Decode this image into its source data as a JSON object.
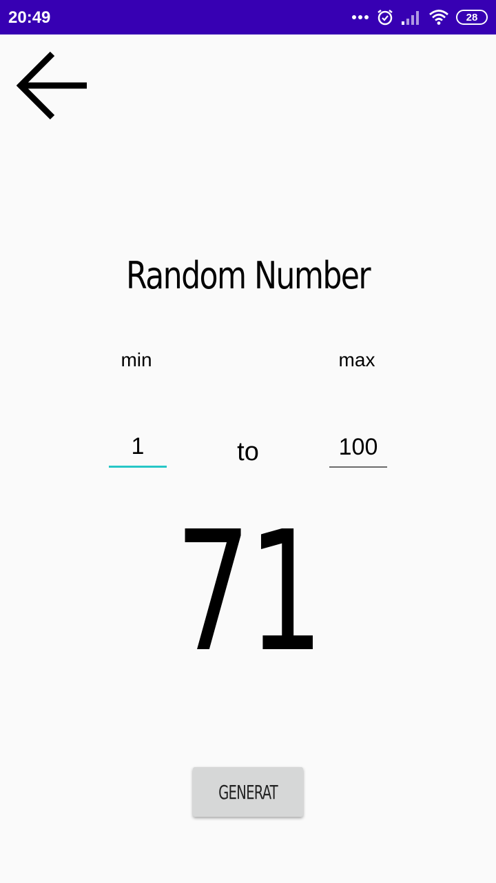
{
  "status_bar": {
    "time": "20:49",
    "battery": "28",
    "background_color": "#3700b3",
    "icons": [
      "more-dots-icon",
      "alarm-icon",
      "signal-icon",
      "wifi-icon",
      "battery-icon"
    ]
  },
  "toolbar": {
    "back_icon": "arrow-left-icon"
  },
  "main": {
    "title": "Random Number",
    "min_label": "min",
    "max_label": "max",
    "min_value": "1",
    "max_value": "100",
    "to_label": "to",
    "result": "71",
    "generate_label": "GENERAT",
    "accent_color": "#26c6c6"
  }
}
